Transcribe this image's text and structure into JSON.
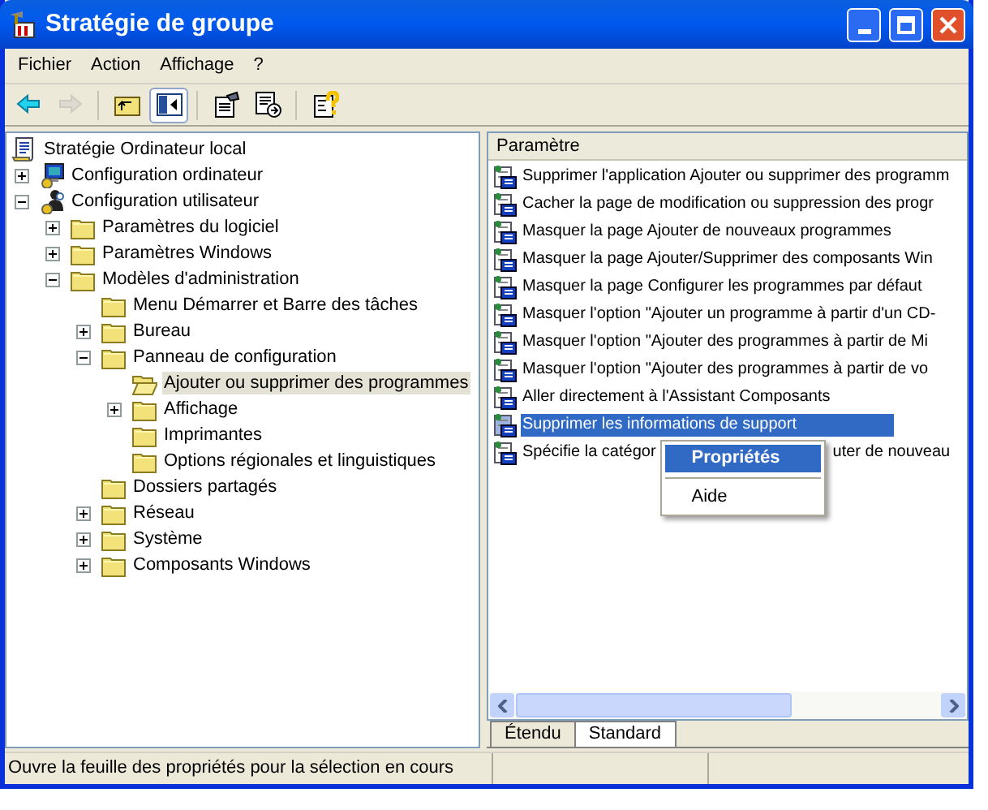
{
  "window": {
    "title": "Stratégie de groupe"
  },
  "menu_bar": [
    "Fichier",
    "Action",
    "Affichage",
    "?"
  ],
  "toolbar": [
    {
      "kind": "back",
      "disabled": false,
      "pressed": false
    },
    {
      "kind": "forward",
      "disabled": true,
      "pressed": false
    },
    {
      "kind": "up",
      "disabled": false,
      "pressed": false
    },
    {
      "kind": "tree",
      "disabled": false,
      "pressed": true
    },
    {
      "kind": "properties",
      "disabled": false,
      "pressed": false
    },
    {
      "kind": "export",
      "disabled": false,
      "pressed": false
    },
    {
      "kind": "help",
      "disabled": false,
      "pressed": false
    }
  ],
  "tree": [
    {
      "label": "Stratégie Ordinateur local",
      "kind": "policy",
      "selected": false,
      "children": [
        {
          "label": "Configuration ordinateur",
          "kind": "computer",
          "expanded": false,
          "selected": false
        },
        {
          "label": "Configuration utilisateur",
          "kind": "user",
          "expanded": true,
          "selected": false,
          "children": [
            {
              "label": "Paramètres du logiciel",
              "kind": "folder",
              "expanded": false,
              "selected": false
            },
            {
              "label": "Paramètres Windows",
              "kind": "folder",
              "expanded": false,
              "selected": false
            },
            {
              "label": "Modèles d'administration",
              "kind": "folder",
              "expanded": true,
              "selected": false,
              "children": [
                {
                  "label": "Menu Démarrer et Barre des tâches",
                  "kind": "folder",
                  "selected": false
                },
                {
                  "label": "Bureau",
                  "kind": "folder",
                  "expanded": false,
                  "selected": false
                },
                {
                  "label": "Panneau de configuration",
                  "kind": "folder",
                  "expanded": true,
                  "selected": false,
                  "children": [
                    {
                      "label": "Ajouter ou supprimer des programmes",
                      "kind": "folder",
                      "selected": true
                    },
                    {
                      "label": "Affichage",
                      "kind": "folder",
                      "expanded": false,
                      "selected": false
                    },
                    {
                      "label": "Imprimantes",
                      "kind": "folder",
                      "selected": false
                    },
                    {
                      "label": "Options régionales et linguistiques",
                      "kind": "folder",
                      "selected": false
                    }
                  ]
                },
                {
                  "label": "Dossiers partagés",
                  "kind": "folder",
                  "selected": false
                },
                {
                  "label": "Réseau",
                  "kind": "folder",
                  "expanded": false,
                  "selected": false
                },
                {
                  "label": "Système",
                  "kind": "folder",
                  "expanded": false,
                  "selected": false
                },
                {
                  "label": "Composants Windows",
                  "kind": "folder",
                  "expanded": false,
                  "selected": false
                }
              ]
            }
          ]
        }
      ]
    }
  ],
  "list": {
    "column": "Paramètre",
    "rows": [
      {
        "text": "Supprimer l'application Ajouter ou supprimer des programm",
        "selected": false
      },
      {
        "text": "Cacher la page de modification ou suppression des progr",
        "selected": false
      },
      {
        "text": "Masquer la page Ajouter de nouveaux programmes",
        "selected": false
      },
      {
        "text": "Masquer la page Ajouter/Supprimer des composants Win",
        "selected": false
      },
      {
        "text": "Masquer la page Configurer les programmes par défaut",
        "selected": false
      },
      {
        "text": "Masquer l'option \"Ajouter un programme à partir d'un CD-",
        "selected": false
      },
      {
        "text": "Masquer l'option \"Ajouter des programmes à partir de Mi",
        "selected": false
      },
      {
        "text": "Masquer l'option \"Ajouter des programmes à partir de vo",
        "selected": false
      },
      {
        "text": "Aller directement à l'Assistant Composants",
        "selected": false
      },
      {
        "text": "Supprimer les informations de support",
        "selected": true
      },
      {
        "text": "Spécifie la catégor",
        "tail": "uter de nouveau",
        "selected": false
      }
    ]
  },
  "context_menu": [
    {
      "label": "Propriétés",
      "selected": true
    },
    {
      "label": "Aide",
      "selected": false
    }
  ],
  "tabs": [
    {
      "label": "Étendu",
      "selected": false
    },
    {
      "label": "Standard",
      "selected": true
    }
  ],
  "status_bar": "Ouvre la feuille des propriétés pour la sélection en cours"
}
